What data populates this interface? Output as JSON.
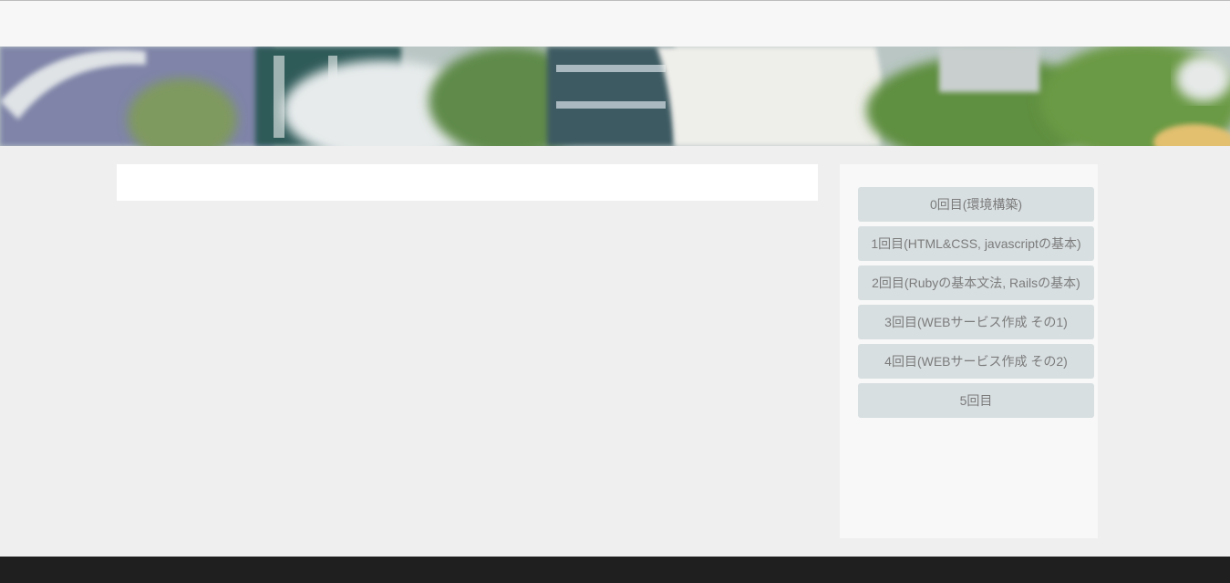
{
  "sidebar": {
    "items": [
      {
        "label": "0回目(環境構築)"
      },
      {
        "label": "1回目(HTML&CSS, javascriptの基本)"
      },
      {
        "label": "2回目(Rubyの基本文法, Railsの基本)"
      },
      {
        "label": "3回目(WEBサービス作成 その1)"
      },
      {
        "label": "4回目(WEBサービス作成 その2)"
      },
      {
        "label": "5回目"
      }
    ]
  },
  "colors": {
    "page_background": "#efefef",
    "nav_item_background": "#d8dfe1",
    "nav_item_text": "#7b7b7b",
    "footer": "#1f1f1f"
  }
}
